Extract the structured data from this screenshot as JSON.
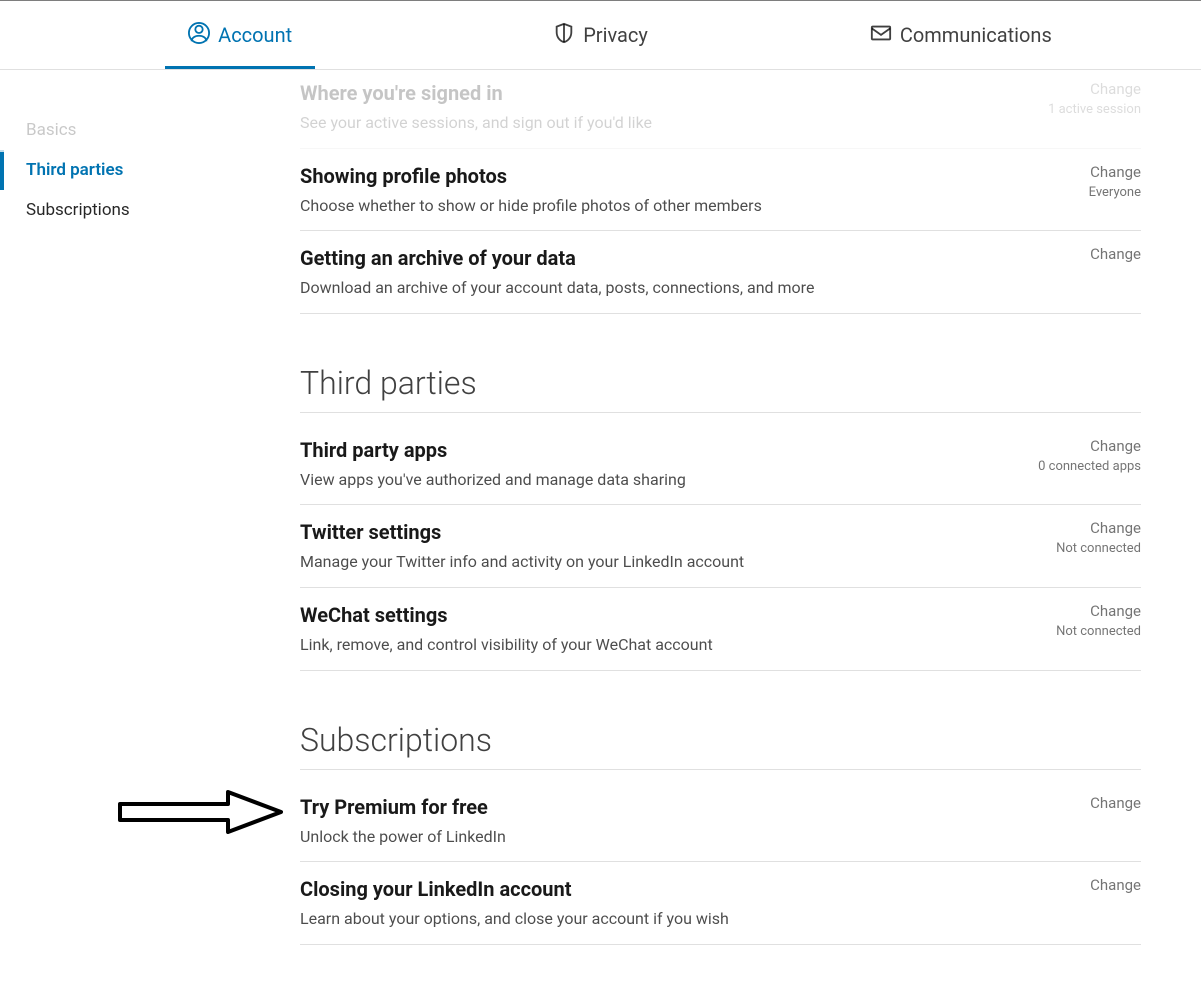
{
  "topnav": {
    "account": "Account",
    "privacy": "Privacy",
    "communications": "Communications"
  },
  "sidebar": {
    "items": [
      {
        "label": "Basics"
      },
      {
        "label": "Third parties"
      },
      {
        "label": "Subscriptions"
      }
    ]
  },
  "sections": {
    "basics_partial": [
      {
        "title": "Where you're signed in",
        "desc": "See your active sessions, and sign out if you'd like",
        "change": "Change",
        "status": "1 active session"
      },
      {
        "title": "Showing profile photos",
        "desc": "Choose whether to show or hide profile photos of other members",
        "change": "Change",
        "status": "Everyone"
      },
      {
        "title": "Getting an archive of your data",
        "desc": "Download an archive of your account data, posts, connections, and more",
        "change": "Change",
        "status": ""
      }
    ],
    "third_parties_heading": "Third parties",
    "third_parties": [
      {
        "title": "Third party apps",
        "desc": "View apps you've authorized and manage data sharing",
        "change": "Change",
        "status": "0 connected apps"
      },
      {
        "title": "Twitter settings",
        "desc": "Manage your Twitter info and activity on your LinkedIn account",
        "change": "Change",
        "status": "Not connected"
      },
      {
        "title": "WeChat settings",
        "desc": "Link, remove, and control visibility of your WeChat account",
        "change": "Change",
        "status": "Not connected"
      }
    ],
    "subscriptions_heading": "Subscriptions",
    "subscriptions": [
      {
        "title": "Try Premium for free",
        "desc": "Unlock the power of LinkedIn",
        "change": "Change",
        "status": ""
      },
      {
        "title": "Closing your LinkedIn account",
        "desc": "Learn about your options, and close your account if you wish",
        "change": "Change",
        "status": ""
      }
    ]
  }
}
